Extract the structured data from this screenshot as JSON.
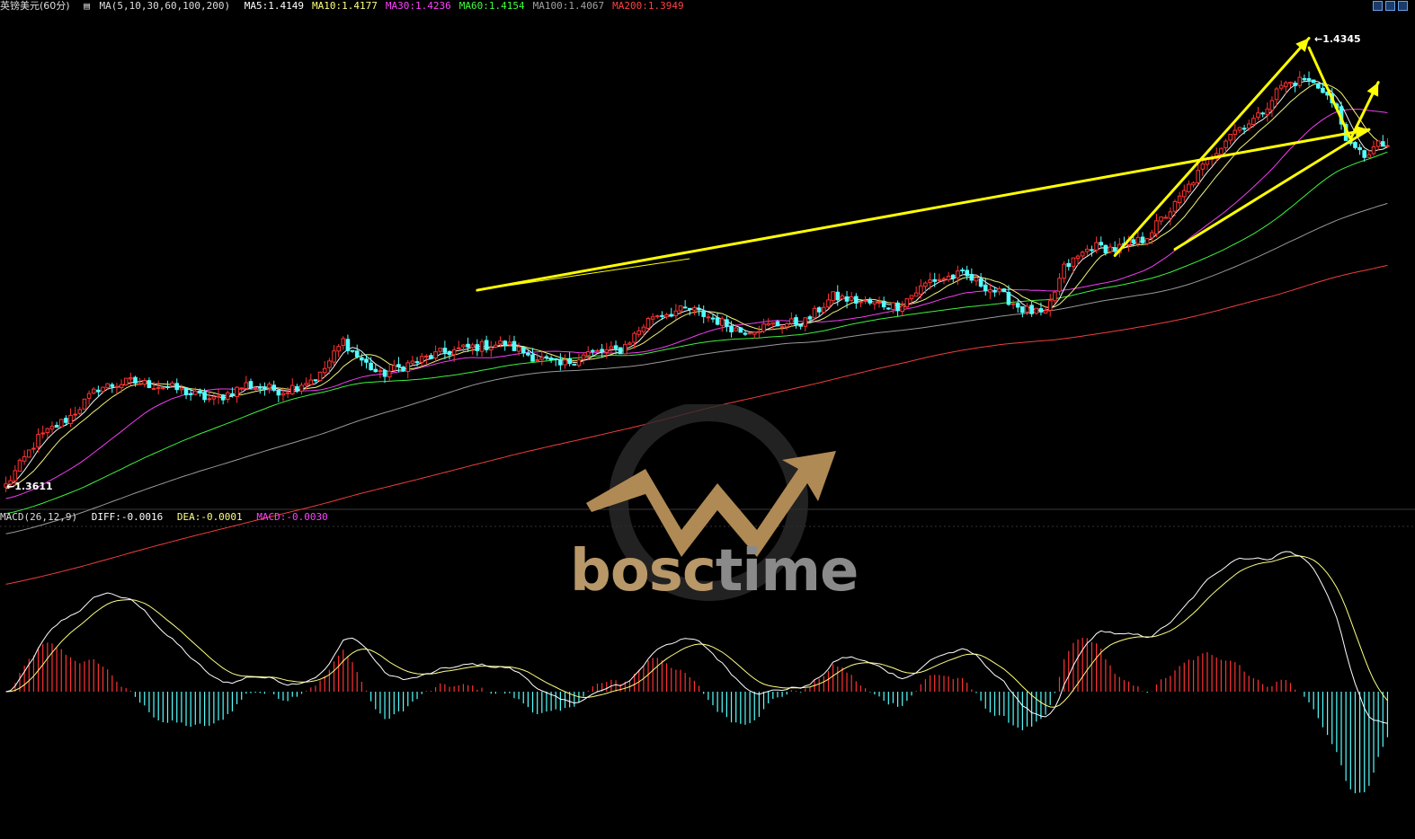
{
  "header": {
    "symbol": "英镑美元(60分)",
    "ma_label": "MA(5,10,30,60,100,200)",
    "ma_items": [
      {
        "name": "MA5",
        "text": "MA5:1.4149",
        "color": "#ffffff"
      },
      {
        "name": "MA10",
        "text": "MA10:1.4177",
        "color": "#ffff80"
      },
      {
        "name": "MA30",
        "text": "MA30:1.4236",
        "color": "#ff40ff"
      },
      {
        "name": "MA60",
        "text": "MA60:1.4154",
        "color": "#40ff40"
      },
      {
        "name": "MA100",
        "text": "MA100:1.4067",
        "color": "#a0a0a0"
      },
      {
        "name": "MA200",
        "text": "MA200:1.3949",
        "color": "#ff4040"
      }
    ]
  },
  "macd_header": {
    "label": "MACD(26,12,9)",
    "diff": "DIFF:-0.0016",
    "dea": "DEA:-0.0001",
    "macd": "MACD:-0.0030",
    "diff_color": "#ffffff",
    "dea_color": "#ffff80",
    "macd_color": "#ff40ff"
  },
  "price_labels": {
    "low": "←1.3611",
    "high": "←1.4345"
  },
  "watermark": {
    "part1": "bosc",
    "part2": "time"
  },
  "colors": {
    "up_candle": "#ff3232",
    "down_candle": "#54ffff",
    "background": "#000000",
    "annotation": "#ffff00",
    "hist_pos": "#ff3232",
    "hist_neg": "#54ffff"
  },
  "chart_data": [
    {
      "type": "candlestick",
      "title": "英镑美元(60分)",
      "ylim": [
        1.359,
        1.437
      ],
      "bars": 300,
      "max_price": 1.4345,
      "min_price": 1.3611,
      "close_anchors": [
        [
          0,
          1.3625
        ],
        [
          10,
          1.37
        ],
        [
          20,
          1.3735
        ],
        [
          28,
          1.378
        ],
        [
          38,
          1.379
        ],
        [
          50,
          1.378
        ],
        [
          62,
          1.376
        ],
        [
          72,
          1.3785
        ],
        [
          84,
          1.3775
        ],
        [
          95,
          1.38
        ],
        [
          102,
          1.3855
        ],
        [
          106,
          1.383
        ],
        [
          112,
          1.38
        ],
        [
          120,
          1.3815
        ],
        [
          130,
          1.3835
        ],
        [
          140,
          1.3845
        ],
        [
          150,
          1.385
        ],
        [
          158,
          1.383
        ],
        [
          166,
          1.3815
        ],
        [
          175,
          1.3835
        ],
        [
          185,
          1.384
        ],
        [
          195,
          1.3895
        ],
        [
          205,
          1.3905
        ],
        [
          213,
          1.389
        ],
        [
          221,
          1.387
        ],
        [
          230,
          1.388
        ],
        [
          240,
          1.3885
        ],
        [
          248,
          1.3925
        ],
        [
          258,
          1.3915
        ],
        [
          268,
          1.391
        ],
        [
          278,
          1.395
        ],
        [
          288,
          1.396
        ],
        [
          298,
          1.393
        ],
        [
          306,
          1.3905
        ],
        [
          312,
          1.3895
        ],
        [
          318,
          1.397
        ],
        [
          326,
          1.4005
        ],
        [
          334,
          1.4
        ],
        [
          342,
          1.4015
        ],
        [
          352,
          1.407
        ],
        [
          360,
          1.413
        ],
        [
          368,
          1.4185
        ],
        [
          376,
          1.421
        ],
        [
          384,
          1.426
        ],
        [
          390,
          1.427
        ],
        [
          396,
          1.4255
        ],
        [
          400,
          1.422
        ],
        [
          404,
          1.416
        ],
        [
          408,
          1.415
        ],
        [
          412,
          1.4165
        ]
      ],
      "close_anchor_scale": 0.72,
      "moving_averages": [
        {
          "name": "MA5",
          "period": 5,
          "color": "#ffffff"
        },
        {
          "name": "MA10",
          "period": 10,
          "color": "#ffff80"
        },
        {
          "name": "MA30",
          "period": 30,
          "color": "#ff40ff"
        },
        {
          "name": "MA60",
          "period": 60,
          "color": "#40ff40"
        },
        {
          "name": "MA100",
          "period": 100,
          "color": "#a0a0a0"
        },
        {
          "name": "MA200",
          "period": 200,
          "color": "#ff4040"
        }
      ],
      "annotations": [
        {
          "type": "line",
          "from": [
            141,
            1.3935
          ],
          "to": [
            410,
            1.419
          ],
          "arrow": true,
          "width": 3
        },
        {
          "type": "line",
          "from": [
            141,
            1.3935
          ],
          "to": [
            141,
            1.3935
          ],
          "arrow": false,
          "width": 1
        },
        {
          "type": "line",
          "from": [
            334,
            1.399
          ],
          "to": [
            392,
            1.4335
          ],
          "arrow": true,
          "width": 3
        },
        {
          "type": "line",
          "from": [
            392,
            1.432
          ],
          "to": [
            404,
            1.4175
          ],
          "arrow": false,
          "width": 3
        },
        {
          "type": "line",
          "from": [
            404,
            1.4175
          ],
          "to": [
            413,
            1.4265
          ],
          "arrow": true,
          "width": 3
        },
        {
          "type": "line",
          "from": [
            352,
            1.4
          ],
          "to": [
            410,
            1.419
          ],
          "arrow": false,
          "width": 3
        }
      ]
    },
    {
      "type": "macd",
      "title": "MACD(26,12,9)",
      "series": [
        {
          "name": "DIFF",
          "color": "#ffffff"
        },
        {
          "name": "DEA",
          "color": "#ffff80"
        },
        {
          "name": "MACD",
          "color": "#ff40ff"
        }
      ],
      "last": {
        "DIFF": -0.0016,
        "DEA": -0.0001,
        "MACD": -0.003
      }
    }
  ]
}
